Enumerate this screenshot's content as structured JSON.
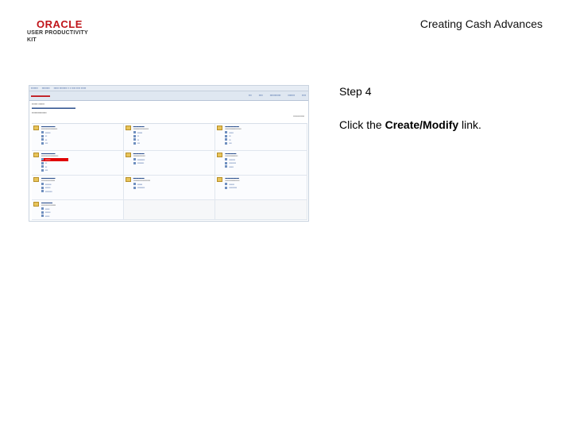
{
  "header": {
    "logo_text": "ORACLE",
    "logo_subtext": "USER PRODUCTIVITY KIT",
    "title": "Creating Cash Advances"
  },
  "step": {
    "label": "Step 4",
    "instruction_prefix": "Click the ",
    "instruction_target": "Create/Modify",
    "instruction_suffix": " link."
  },
  "screenshot": {
    "highlight_color": "#e00000",
    "brand_color": "#c0141a"
  }
}
